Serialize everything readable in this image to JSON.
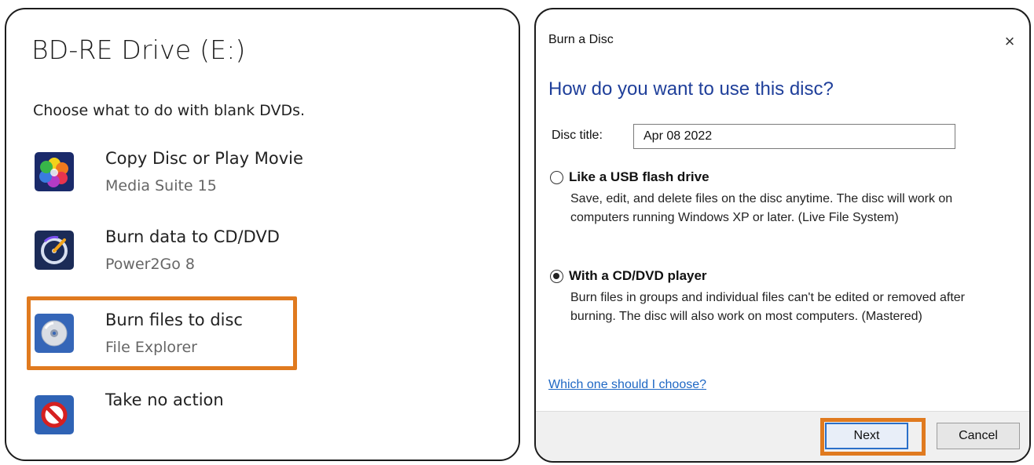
{
  "autoplay": {
    "title": "BD-RE Drive (E:)",
    "subtitle": "Choose what to do with blank DVDs.",
    "options": [
      {
        "label": "Copy Disc or Play Movie",
        "app": "Media Suite 15",
        "icon": "media-suite-icon"
      },
      {
        "label": "Burn data to CD/DVD",
        "app": "Power2Go 8",
        "icon": "power2go-icon"
      },
      {
        "label": "Burn files to disc",
        "app": "File Explorer",
        "icon": "disc-icon",
        "highlighted": true
      },
      {
        "label": "Take no action",
        "app": "",
        "icon": "no-action-icon"
      }
    ],
    "highlight_color": "#e07a1f"
  },
  "burn_dialog": {
    "window_title": "Burn a Disc",
    "close_glyph": "×",
    "heading": "How do you want to use this disc?",
    "disc_title_label": "Disc title:",
    "disc_title_value": "Apr 08 2022",
    "options": [
      {
        "label": "Like a USB flash drive",
        "description": "Save, edit, and delete files on the disc anytime. The disc will work on computers running Windows XP or later. (Live File System)",
        "selected": false
      },
      {
        "label": "With a CD/DVD player",
        "description": "Burn files in groups and individual files can't be edited or removed after burning. The disc will also work on most computers. (Mastered)",
        "selected": true
      }
    ],
    "help_link": "Which one should I choose?",
    "next_label": "Next",
    "cancel_label": "Cancel",
    "heading_color": "#1f3f9a",
    "link_color": "#1e67c4"
  }
}
